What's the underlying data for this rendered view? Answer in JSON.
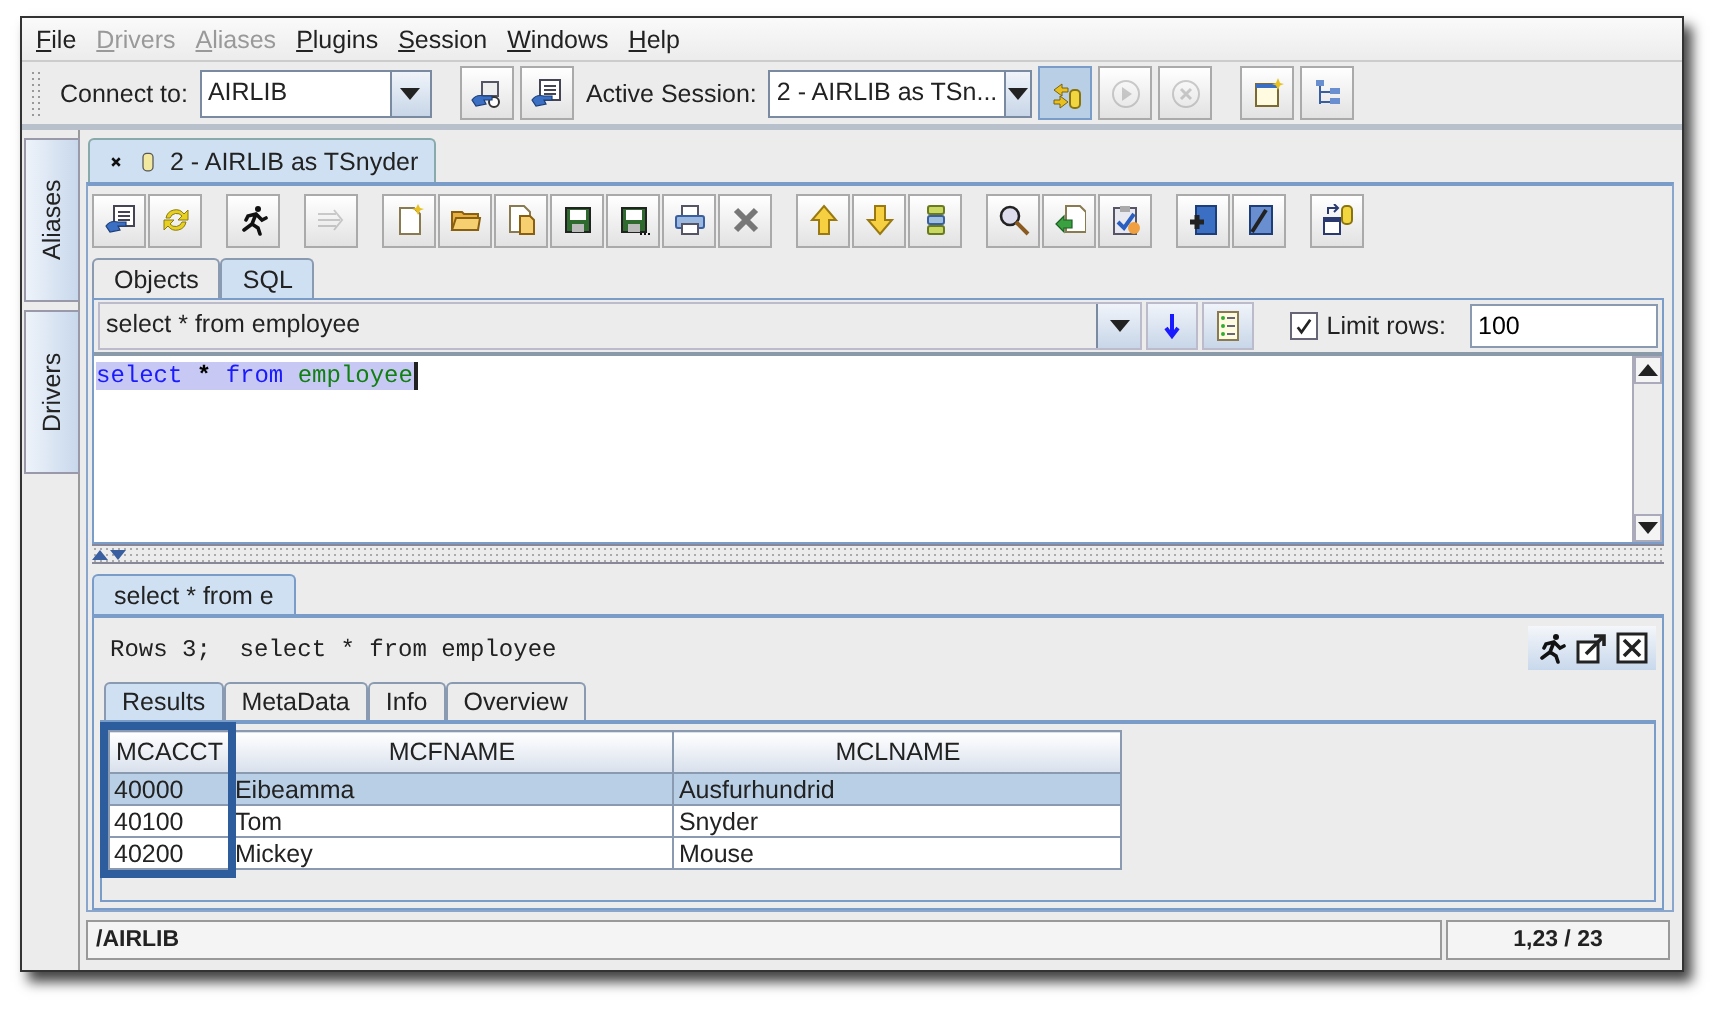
{
  "menu": [
    {
      "label": "File",
      "disabled": false
    },
    {
      "label": "Drivers",
      "disabled": true
    },
    {
      "label": "Aliases",
      "disabled": true
    },
    {
      "label": "Plugins",
      "disabled": false
    },
    {
      "label": "Session",
      "disabled": false
    },
    {
      "label": "Windows",
      "disabled": false
    },
    {
      "label": "Help",
      "disabled": false
    }
  ],
  "main_toolbar": {
    "connect_label": "Connect to:",
    "connect_value": "AIRLIB",
    "session_label": "Active Session:",
    "session_value": "2 - AIRLIB as TSn...",
    "groups": [
      [
        {
          "disabled": false,
          "pressed": false
        },
        {
          "disabled": false,
          "pressed": false
        }
      ],
      [
        {
          "disabled": false,
          "pressed": true
        },
        {
          "disabled": true,
          "pressed": false
        },
        {
          "disabled": true,
          "pressed": false
        }
      ],
      [
        {
          "disabled": false,
          "pressed": false
        },
        {
          "disabled": false,
          "pressed": false
        }
      ]
    ]
  },
  "sidebar": {
    "tabs": [
      {
        "label": "Aliases"
      },
      {
        "label": "Drivers"
      }
    ]
  },
  "session_tabs": [
    {
      "label": "2 - AIRLIB as TSnyder",
      "selected": true
    }
  ],
  "session_toolbar": {
    "groups": [
      [
        {
          "disabled": false
        },
        {
          "disabled": false
        }
      ],
      [
        {
          "disabled": false
        }
      ],
      [
        {
          "disabled": true
        }
      ],
      [
        {
          "disabled": false
        },
        {
          "disabled": false
        },
        {
          "disabled": false
        },
        {
          "disabled": false
        },
        {
          "disabled": false
        },
        {
          "disabled": false
        },
        {
          "disabled": false
        }
      ],
      [
        {
          "disabled": false
        },
        {
          "disabled": false
        },
        {
          "disabled": false
        }
      ],
      [
        {
          "disabled": false
        },
        {
          "disabled": false
        },
        {
          "disabled": false
        }
      ],
      [
        {
          "disabled": false
        },
        {
          "disabled": false
        }
      ],
      [
        {
          "disabled": false
        }
      ]
    ]
  },
  "object_tabs": [
    {
      "label": "Objects",
      "selected": false
    },
    {
      "label": "SQL",
      "selected": true
    }
  ],
  "sql_history": {
    "value": "select * from employee"
  },
  "limit_rows": {
    "checked": true,
    "label": "Limit rows:",
    "value": "100"
  },
  "editor": {
    "selected": true,
    "tokens": [
      {
        "text": "select",
        "kind": "keyword"
      },
      {
        "text": "*",
        "kind": "operator"
      },
      {
        "text": "from",
        "kind": "keyword"
      },
      {
        "text": "employee",
        "kind": "table"
      }
    ]
  },
  "result_tabs": [
    {
      "label": "select * from e",
      "selected": true
    }
  ],
  "result": {
    "summary": "Rows 3;  select * from employee",
    "tabs": [
      {
        "label": "Results",
        "selected": true
      },
      {
        "label": "MetaData",
        "selected": false
      },
      {
        "label": "Info",
        "selected": false
      },
      {
        "label": "Overview",
        "selected": false
      }
    ],
    "table": {
      "columns": [
        {
          "label": "MCACCT",
          "highlighted": true
        },
        {
          "label": "MCFNAME",
          "highlighted": false
        },
        {
          "label": "MCLNAME",
          "highlighted": false
        }
      ],
      "rows": [
        {
          "cells": [
            "40000",
            "Eibeamma",
            "Ausfurhundrid"
          ],
          "selected": true
        },
        {
          "cells": [
            "40100",
            "Tom",
            "Snyder"
          ],
          "selected": false
        },
        {
          "cells": [
            "40200",
            "Mickey",
            "Mouse"
          ],
          "selected": false
        }
      ]
    }
  },
  "status_bar": {
    "path": "/AIRLIB",
    "position": "1,23 / 23"
  }
}
